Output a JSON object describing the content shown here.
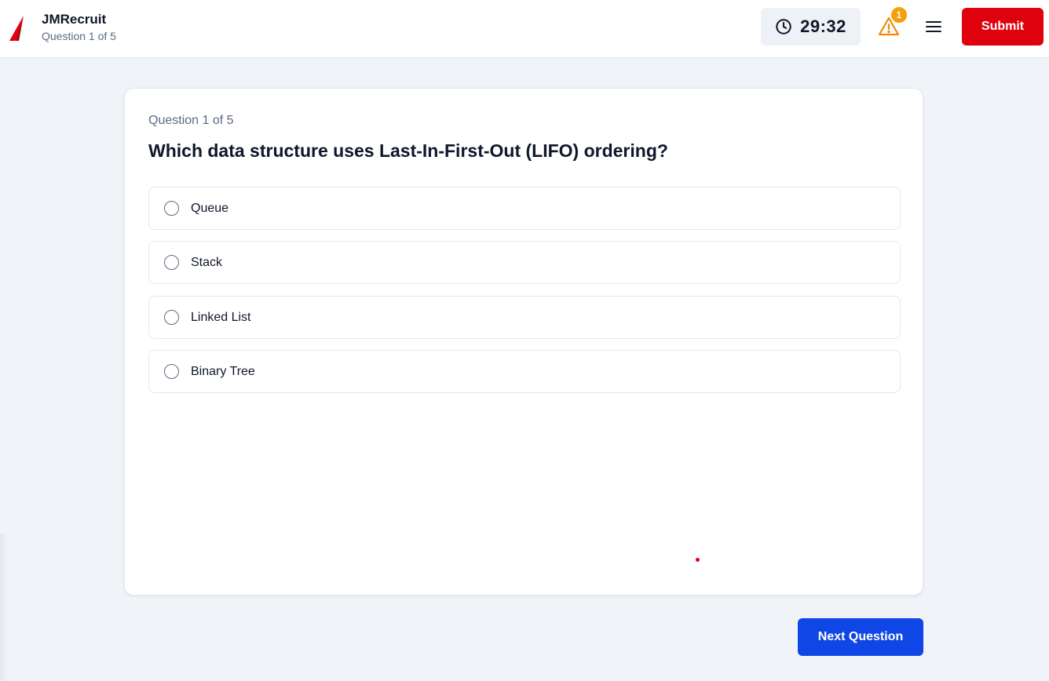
{
  "header": {
    "app_name": "JMRecruit",
    "subtitle": "Question 1 of 5",
    "timer": "29:32",
    "warning_count": "1",
    "submit_label": "Submit"
  },
  "question": {
    "meta": "Question 1 of 5",
    "text": "Which data structure uses Last-In-First-Out (LIFO) ordering?",
    "options": [
      {
        "label": "Queue"
      },
      {
        "label": "Stack"
      },
      {
        "label": "Linked List"
      },
      {
        "label": "Binary Tree"
      }
    ]
  },
  "footer": {
    "next_label": "Next Question"
  },
  "icons": {
    "logo": "jm-logo-icon",
    "timer": "clock-icon",
    "warning": "warning-triangle-icon",
    "menu": "hamburger-menu-icon"
  },
  "colors": {
    "brand_red": "#e0010e",
    "primary_blue": "#0f47e6",
    "warning_orange": "#f59f0a"
  }
}
